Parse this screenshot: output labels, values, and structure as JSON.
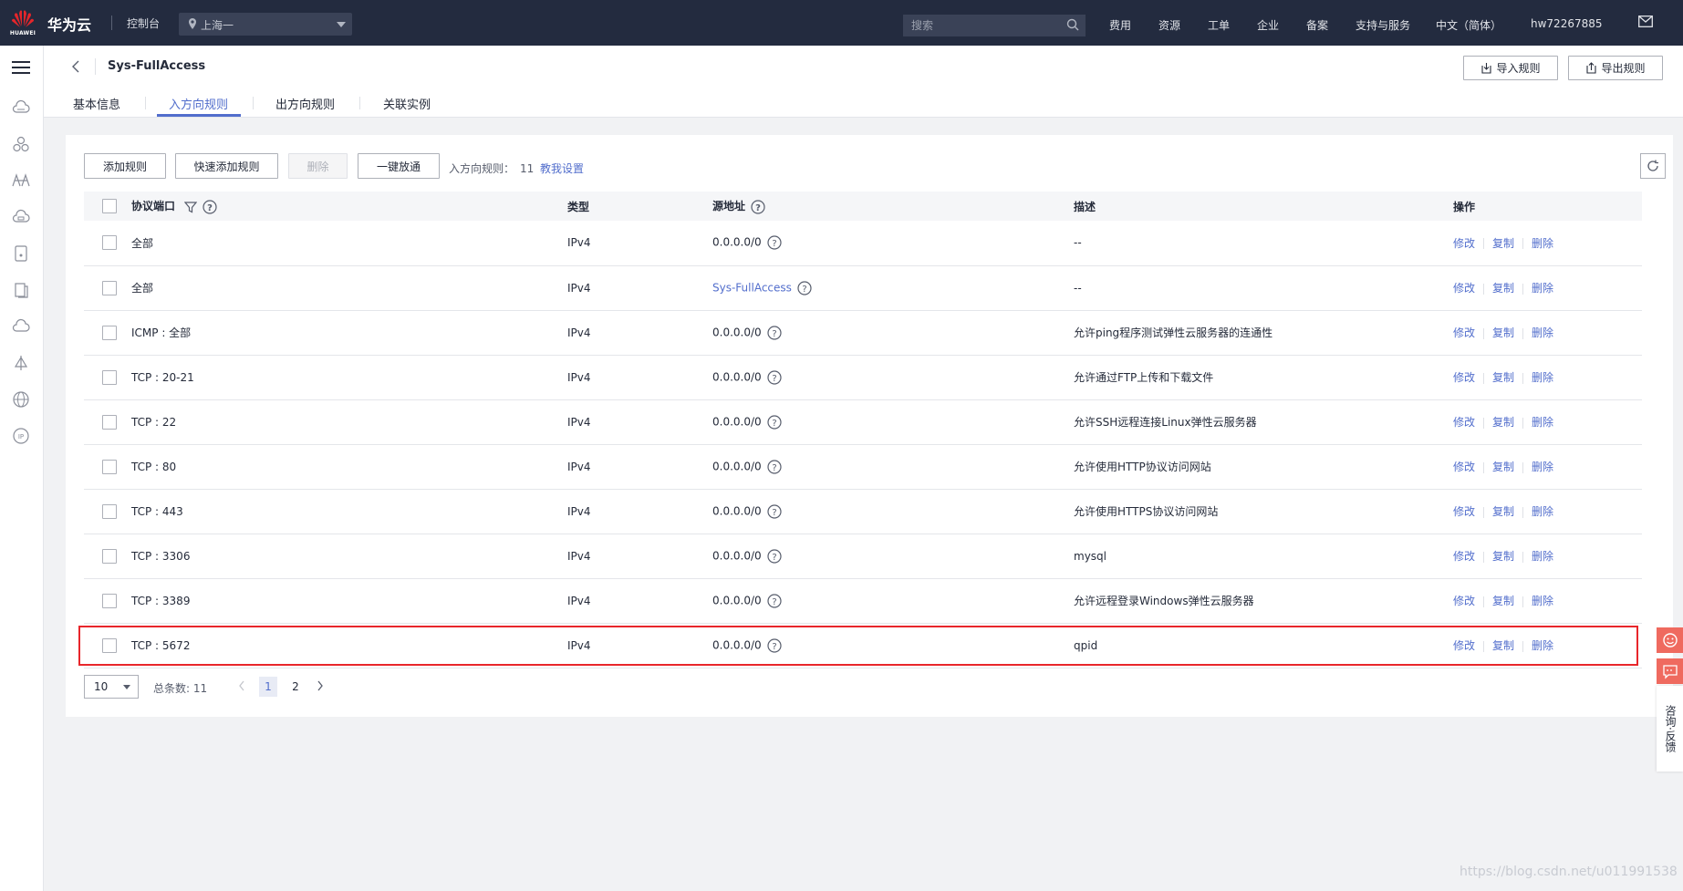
{
  "brand": {
    "name": "华为云",
    "sub": "HUAWEI"
  },
  "topbar": {
    "console": "控制台",
    "region": "上海一",
    "search_placeholder": "搜索",
    "nav": [
      "费用",
      "资源",
      "工单",
      "企业",
      "备案",
      "支持与服务",
      "中文（简体）",
      "hw72267885"
    ]
  },
  "header": {
    "title": "Sys-FullAccess",
    "import_label": "导入规则",
    "export_label": "导出规则",
    "tabs": [
      "基本信息",
      "入方向规则",
      "出方向规则",
      "关联实例"
    ]
  },
  "toolbar": {
    "add": "添加规则",
    "quick_add": "快速添加规则",
    "delete": "删除",
    "allow_all": "一键放通",
    "count_label": "入方向规则：",
    "count": "11",
    "help": "教我设置"
  },
  "table": {
    "columns": [
      "协议端口",
      "类型",
      "源地址",
      "描述",
      "操作"
    ],
    "actions": [
      "修改",
      "复制",
      "删除"
    ],
    "rows": [
      {
        "port": "全部",
        "type": "IPv4",
        "source": "0.0.0.0/0",
        "source_link": false,
        "desc": "--"
      },
      {
        "port": "全部",
        "type": "IPv4",
        "source": "Sys-FullAccess",
        "source_link": true,
        "desc": "--"
      },
      {
        "port": "ICMP : 全部",
        "type": "IPv4",
        "source": "0.0.0.0/0",
        "source_link": false,
        "desc": "允许ping程序测试弹性云服务器的连通性"
      },
      {
        "port": "TCP : 20-21",
        "type": "IPv4",
        "source": "0.0.0.0/0",
        "source_link": false,
        "desc": "允许通过FTP上传和下载文件"
      },
      {
        "port": "TCP : 22",
        "type": "IPv4",
        "source": "0.0.0.0/0",
        "source_link": false,
        "desc": "允许SSH远程连接Linux弹性云服务器"
      },
      {
        "port": "TCP : 80",
        "type": "IPv4",
        "source": "0.0.0.0/0",
        "source_link": false,
        "desc": "允许使用HTTP协议访问网站"
      },
      {
        "port": "TCP : 443",
        "type": "IPv4",
        "source": "0.0.0.0/0",
        "source_link": false,
        "desc": "允许使用HTTPS协议访问网站"
      },
      {
        "port": "TCP : 3306",
        "type": "IPv4",
        "source": "0.0.0.0/0",
        "source_link": false,
        "desc": "mysql"
      },
      {
        "port": "TCP : 3389",
        "type": "IPv4",
        "source": "0.0.0.0/0",
        "source_link": false,
        "desc": "允许远程登录Windows弹性云服务器"
      },
      {
        "port": "TCP : 5672",
        "type": "IPv4",
        "source": "0.0.0.0/0",
        "source_link": false,
        "desc": "qpid"
      }
    ]
  },
  "pagination": {
    "page_size": "10",
    "total": "总条数: 11",
    "pages": [
      "1",
      "2"
    ],
    "current": "1"
  },
  "float": {
    "feedback": "咨询·反馈"
  },
  "watermark": "https://blog.csdn.net/u011991538",
  "colors": {
    "topbar": "#232b3f",
    "accent": "#526ecc",
    "highlight": "#e8262b",
    "float": "#ef6a5f"
  }
}
